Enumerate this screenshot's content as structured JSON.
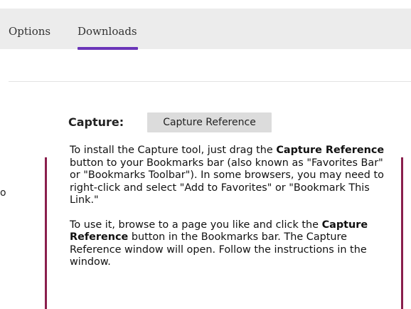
{
  "tabs": {
    "options_label": "Options",
    "downloads_label": "Downloads",
    "active": "Downloads"
  },
  "colors": {
    "accent": "#6a35b8",
    "sidebar_bar": "#8a1f4d",
    "tabbar_background": "#ececec",
    "button_background": "#dcdcdc"
  },
  "capture": {
    "label": "Capture:",
    "button_label": "Capture Reference"
  },
  "left_fragment": "o",
  "instructions": {
    "p1_before": "To install the Capture tool, just drag the ",
    "p1_bold": "Capture Reference",
    "p1_after": " button to your Bookmarks bar (also known as \"Favorites Bar\" or \"Bookmarks Toolbar\"). In some browsers, you may need to right-click and select \"Add to Favorites\" or \"Bookmark This Link.\"",
    "p2_before": "To use it, browse to a page you like and click the ",
    "p2_bold": "Capture Reference",
    "p2_after": " button in the Bookmarks bar. The Capture Reference window will open. Follow the instructions in the window."
  }
}
